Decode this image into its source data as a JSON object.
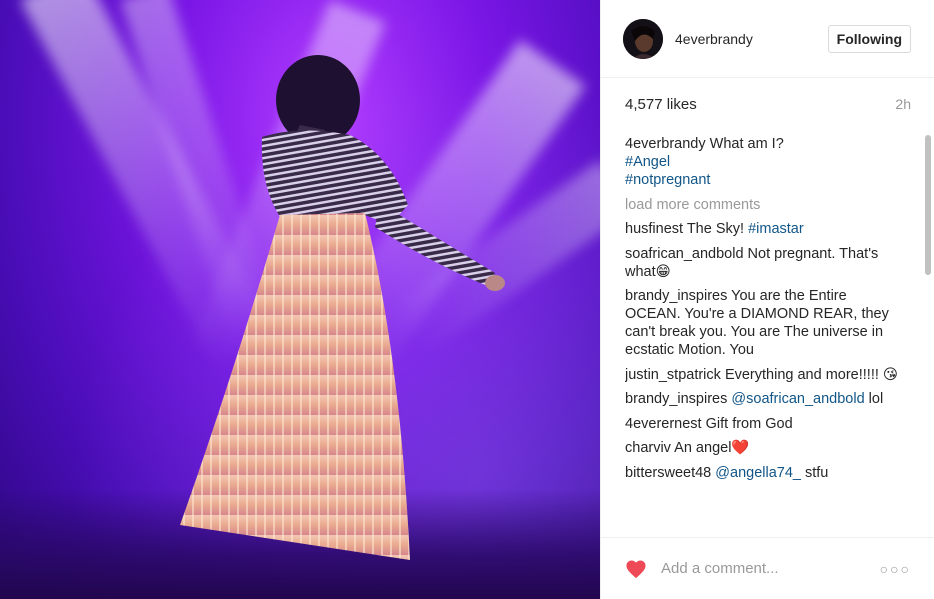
{
  "post": {
    "username": "4everbrandy",
    "follow_label": "Following",
    "likes": "4,577 likes",
    "time": "2h"
  },
  "comments": {
    "caption": {
      "user": "4everbrandy",
      "text": "What am I?",
      "tags": [
        "#Angel",
        "#notpregnant"
      ]
    },
    "load_more": "load more comments",
    "items": [
      {
        "user": "husfinest",
        "text": "The Sky!",
        "tag": "#imastar"
      },
      {
        "user": "soafrican_andbold",
        "text": "Not pregnant. That's what😁"
      },
      {
        "user": "brandy_inspires",
        "text": "You are the Entire OCEAN. You're a DIAMOND REAR, they can't break you. You are The universe in ecstatic Motion. You"
      },
      {
        "user": "justin_stpatrick",
        "text": "Everything and more!!!!! 😘"
      },
      {
        "user": "brandy_inspires",
        "mention": "@soafrican_andbold",
        "text": "lol"
      },
      {
        "user": "4everernest",
        "text": "Gift from God"
      },
      {
        "user": "charviv",
        "text": "An angel❤️"
      },
      {
        "user": "bittersweet48",
        "mention": "@angella74_",
        "text": "stfu"
      }
    ]
  },
  "footer": {
    "add_comment_placeholder": "Add a comment...",
    "more_label": "○○○"
  },
  "colors": {
    "link": "#125688",
    "heart": "#ed4956",
    "muted": "#999999"
  }
}
